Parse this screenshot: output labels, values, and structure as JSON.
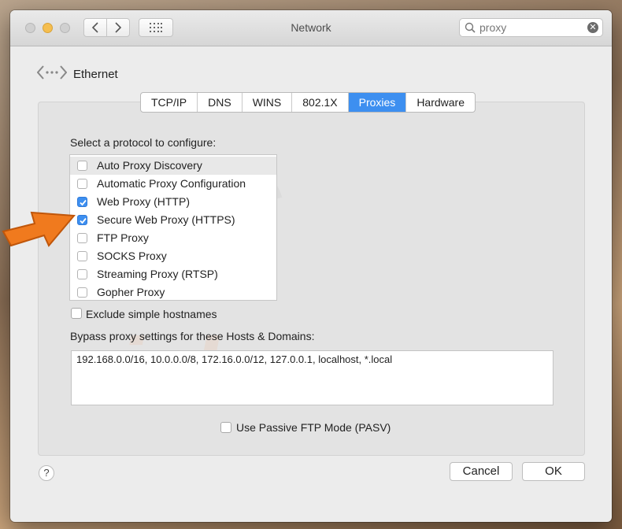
{
  "window": {
    "title": "Network"
  },
  "search": {
    "value": "proxy",
    "placeholder": "Search"
  },
  "ethernet": {
    "label": "Ethernet"
  },
  "tabs": [
    {
      "label": "TCP/IP",
      "active": false
    },
    {
      "label": "DNS",
      "active": false
    },
    {
      "label": "WINS",
      "active": false
    },
    {
      "label": "802.1X",
      "active": false
    },
    {
      "label": "Proxies",
      "active": true
    },
    {
      "label": "Hardware",
      "active": false
    }
  ],
  "protocols": {
    "heading": "Select a protocol to configure:",
    "items": [
      {
        "label": "Auto Proxy Discovery",
        "checked": false
      },
      {
        "label": "Automatic Proxy Configuration",
        "checked": false
      },
      {
        "label": "Web Proxy (HTTP)",
        "checked": true
      },
      {
        "label": "Secure Web Proxy (HTTPS)",
        "checked": true
      },
      {
        "label": "FTP Proxy",
        "checked": false
      },
      {
        "label": "SOCKS Proxy",
        "checked": false
      },
      {
        "label": "Streaming Proxy (RTSP)",
        "checked": false
      },
      {
        "label": "Gopher Proxy",
        "checked": false
      }
    ]
  },
  "exclude_simple": {
    "label": "Exclude simple hostnames",
    "checked": false
  },
  "bypass": {
    "label": "Bypass proxy settings for these Hosts & Domains:",
    "value": "192.168.0.0/16, 10.0.0.0/8, 172.16.0.0/12, 127.0.0.1, localhost, *.local"
  },
  "passive_ftp": {
    "label": "Use Passive FTP Mode (PASV)",
    "checked": false
  },
  "buttons": {
    "help": "?",
    "cancel": "Cancel",
    "ok": "OK"
  },
  "colors": {
    "accent": "#3d8ff0",
    "arrow": "#f07a1e",
    "yellow_light": "#f5be4f"
  }
}
